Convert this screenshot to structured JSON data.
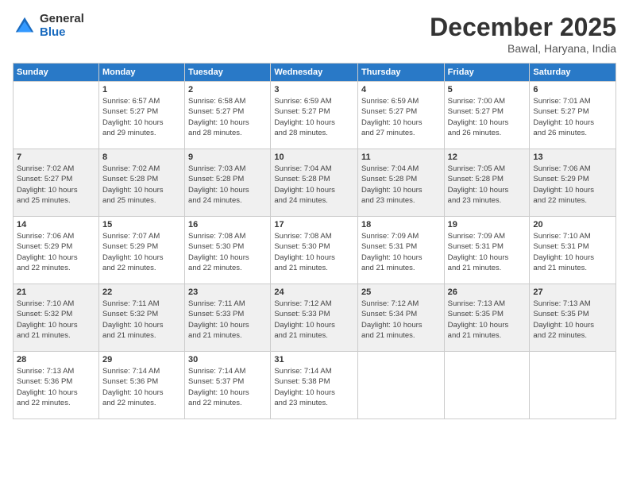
{
  "logo": {
    "general": "General",
    "blue": "Blue"
  },
  "title": "December 2025",
  "location": "Bawal, Haryana, India",
  "days_of_week": [
    "Sunday",
    "Monday",
    "Tuesday",
    "Wednesday",
    "Thursday",
    "Friday",
    "Saturday"
  ],
  "weeks": [
    [
      {
        "day": "",
        "info": ""
      },
      {
        "day": "1",
        "info": "Sunrise: 6:57 AM\nSunset: 5:27 PM\nDaylight: 10 hours\nand 29 minutes."
      },
      {
        "day": "2",
        "info": "Sunrise: 6:58 AM\nSunset: 5:27 PM\nDaylight: 10 hours\nand 28 minutes."
      },
      {
        "day": "3",
        "info": "Sunrise: 6:59 AM\nSunset: 5:27 PM\nDaylight: 10 hours\nand 28 minutes."
      },
      {
        "day": "4",
        "info": "Sunrise: 6:59 AM\nSunset: 5:27 PM\nDaylight: 10 hours\nand 27 minutes."
      },
      {
        "day": "5",
        "info": "Sunrise: 7:00 AM\nSunset: 5:27 PM\nDaylight: 10 hours\nand 26 minutes."
      },
      {
        "day": "6",
        "info": "Sunrise: 7:01 AM\nSunset: 5:27 PM\nDaylight: 10 hours\nand 26 minutes."
      }
    ],
    [
      {
        "day": "7",
        "info": "Sunrise: 7:02 AM\nSunset: 5:27 PM\nDaylight: 10 hours\nand 25 minutes."
      },
      {
        "day": "8",
        "info": "Sunrise: 7:02 AM\nSunset: 5:28 PM\nDaylight: 10 hours\nand 25 minutes."
      },
      {
        "day": "9",
        "info": "Sunrise: 7:03 AM\nSunset: 5:28 PM\nDaylight: 10 hours\nand 24 minutes."
      },
      {
        "day": "10",
        "info": "Sunrise: 7:04 AM\nSunset: 5:28 PM\nDaylight: 10 hours\nand 24 minutes."
      },
      {
        "day": "11",
        "info": "Sunrise: 7:04 AM\nSunset: 5:28 PM\nDaylight: 10 hours\nand 23 minutes."
      },
      {
        "day": "12",
        "info": "Sunrise: 7:05 AM\nSunset: 5:28 PM\nDaylight: 10 hours\nand 23 minutes."
      },
      {
        "day": "13",
        "info": "Sunrise: 7:06 AM\nSunset: 5:29 PM\nDaylight: 10 hours\nand 22 minutes."
      }
    ],
    [
      {
        "day": "14",
        "info": "Sunrise: 7:06 AM\nSunset: 5:29 PM\nDaylight: 10 hours\nand 22 minutes."
      },
      {
        "day": "15",
        "info": "Sunrise: 7:07 AM\nSunset: 5:29 PM\nDaylight: 10 hours\nand 22 minutes."
      },
      {
        "day": "16",
        "info": "Sunrise: 7:08 AM\nSunset: 5:30 PM\nDaylight: 10 hours\nand 22 minutes."
      },
      {
        "day": "17",
        "info": "Sunrise: 7:08 AM\nSunset: 5:30 PM\nDaylight: 10 hours\nand 21 minutes."
      },
      {
        "day": "18",
        "info": "Sunrise: 7:09 AM\nSunset: 5:31 PM\nDaylight: 10 hours\nand 21 minutes."
      },
      {
        "day": "19",
        "info": "Sunrise: 7:09 AM\nSunset: 5:31 PM\nDaylight: 10 hours\nand 21 minutes."
      },
      {
        "day": "20",
        "info": "Sunrise: 7:10 AM\nSunset: 5:31 PM\nDaylight: 10 hours\nand 21 minutes."
      }
    ],
    [
      {
        "day": "21",
        "info": "Sunrise: 7:10 AM\nSunset: 5:32 PM\nDaylight: 10 hours\nand 21 minutes."
      },
      {
        "day": "22",
        "info": "Sunrise: 7:11 AM\nSunset: 5:32 PM\nDaylight: 10 hours\nand 21 minutes."
      },
      {
        "day": "23",
        "info": "Sunrise: 7:11 AM\nSunset: 5:33 PM\nDaylight: 10 hours\nand 21 minutes."
      },
      {
        "day": "24",
        "info": "Sunrise: 7:12 AM\nSunset: 5:33 PM\nDaylight: 10 hours\nand 21 minutes."
      },
      {
        "day": "25",
        "info": "Sunrise: 7:12 AM\nSunset: 5:34 PM\nDaylight: 10 hours\nand 21 minutes."
      },
      {
        "day": "26",
        "info": "Sunrise: 7:13 AM\nSunset: 5:35 PM\nDaylight: 10 hours\nand 21 minutes."
      },
      {
        "day": "27",
        "info": "Sunrise: 7:13 AM\nSunset: 5:35 PM\nDaylight: 10 hours\nand 22 minutes."
      }
    ],
    [
      {
        "day": "28",
        "info": "Sunrise: 7:13 AM\nSunset: 5:36 PM\nDaylight: 10 hours\nand 22 minutes."
      },
      {
        "day": "29",
        "info": "Sunrise: 7:14 AM\nSunset: 5:36 PM\nDaylight: 10 hours\nand 22 minutes."
      },
      {
        "day": "30",
        "info": "Sunrise: 7:14 AM\nSunset: 5:37 PM\nDaylight: 10 hours\nand 22 minutes."
      },
      {
        "day": "31",
        "info": "Sunrise: 7:14 AM\nSunset: 5:38 PM\nDaylight: 10 hours\nand 23 minutes."
      },
      {
        "day": "",
        "info": ""
      },
      {
        "day": "",
        "info": ""
      },
      {
        "day": "",
        "info": ""
      }
    ]
  ]
}
